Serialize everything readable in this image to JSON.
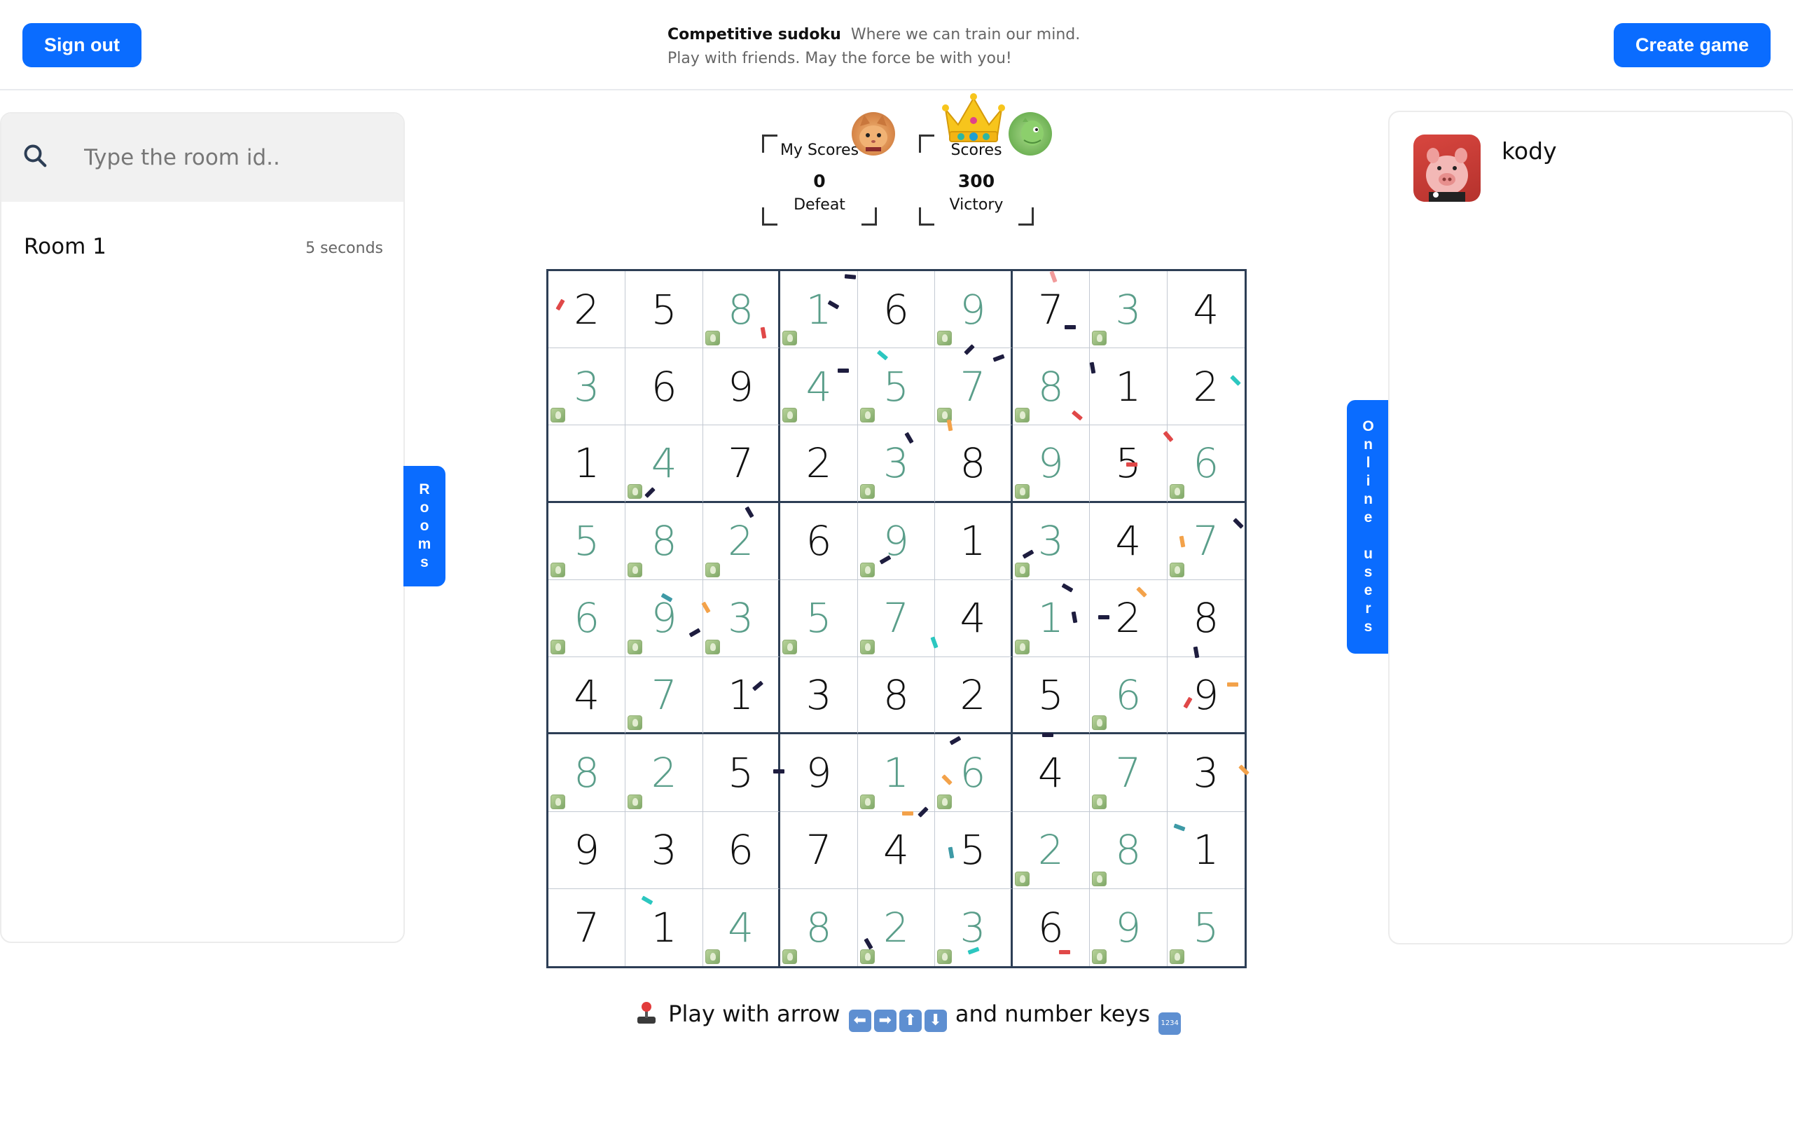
{
  "header": {
    "sign_out_label": "Sign out",
    "create_game_label": "Create game",
    "app_name": "Competitive sudoku",
    "tagline_1": "Where we can train our mind.",
    "tagline_2": "Play with friends. May the force be with you!"
  },
  "rooms": {
    "search_placeholder": "Type the room id..",
    "items": [
      {
        "name": "Room 1",
        "age": "5 seconds"
      }
    ],
    "tab_label": "Rooms"
  },
  "online": {
    "tab_label": "Online users",
    "users": [
      {
        "name": "kody",
        "avatar_icon": "pig-avatar-icon"
      }
    ]
  },
  "scores": {
    "me": {
      "label": "My Scores",
      "value": "0",
      "status": "Defeat",
      "avatar_icon": "cat-avatar-icon"
    },
    "opponent": {
      "label": "Scores",
      "value": "300",
      "status": "Victory",
      "avatar_icon": "dino-avatar-icon",
      "winner_icon": "crown-icon"
    }
  },
  "board": {
    "values": [
      [
        2,
        5,
        8,
        1,
        6,
        9,
        7,
        3,
        4
      ],
      [
        3,
        6,
        9,
        4,
        5,
        7,
        8,
        1,
        2
      ],
      [
        1,
        4,
        7,
        2,
        3,
        8,
        9,
        5,
        6
      ],
      [
        5,
        8,
        2,
        6,
        9,
        1,
        3,
        4,
        7
      ],
      [
        6,
        9,
        3,
        5,
        7,
        4,
        1,
        2,
        8
      ],
      [
        4,
        7,
        1,
        3,
        8,
        2,
        5,
        6,
        9
      ],
      [
        8,
        2,
        5,
        9,
        1,
        6,
        4,
        7,
        3
      ],
      [
        9,
        3,
        6,
        7,
        4,
        5,
        2,
        8,
        1
      ],
      [
        7,
        1,
        4,
        8,
        2,
        3,
        6,
        9,
        5
      ]
    ],
    "filled_by_player": [
      [
        0,
        0,
        1,
        1,
        0,
        1,
        0,
        1,
        0
      ],
      [
        1,
        0,
        0,
        1,
        1,
        1,
        1,
        0,
        0
      ],
      [
        0,
        1,
        0,
        0,
        1,
        0,
        1,
        0,
        1
      ],
      [
        1,
        1,
        1,
        0,
        1,
        0,
        1,
        0,
        1
      ],
      [
        1,
        1,
        1,
        1,
        1,
        0,
        1,
        0,
        0
      ],
      [
        0,
        1,
        0,
        0,
        0,
        0,
        0,
        1,
        0
      ],
      [
        1,
        1,
        0,
        0,
        1,
        1,
        0,
        1,
        0
      ],
      [
        0,
        0,
        0,
        0,
        0,
        0,
        1,
        1,
        0
      ],
      [
        0,
        0,
        1,
        1,
        1,
        1,
        0,
        1,
        1
      ]
    ],
    "colors": {
      "given": "#111111",
      "solved": "#5a9e8a",
      "grid": "#2d3e55"
    }
  },
  "help": {
    "prefix": "Play with arrow",
    "middle": "and number keys",
    "arrow_keys": [
      "⬅",
      "➡",
      "⬆",
      "⬇"
    ],
    "number_key": "1234"
  },
  "colors": {
    "accent": "#0a6cff"
  }
}
